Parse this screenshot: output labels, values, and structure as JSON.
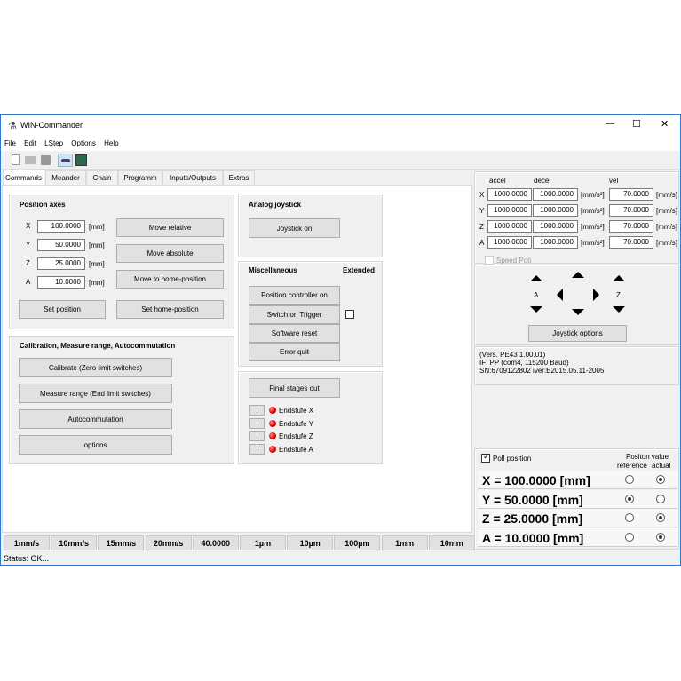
{
  "window": {
    "title": "WIN-Commander",
    "minimize": "—",
    "maximize": "☐",
    "close": "✕"
  },
  "menu": [
    "File",
    "Edit",
    "LStep",
    "Options",
    "Help"
  ],
  "toolbar": [
    "new-file-icon",
    "open-folder-icon",
    "save-icon",
    "connect-icon",
    "settings-tool-icon"
  ],
  "tabs": [
    "Commands",
    "Meander",
    "Chain",
    "Programm",
    "Inputs/Outputs",
    "Extras"
  ],
  "position_axes": {
    "title": "Position axes",
    "unit": "[mm]",
    "axes": [
      {
        "label": "X",
        "value": "100.0000"
      },
      {
        "label": "Y",
        "value": "50.0000"
      },
      {
        "label": "Z",
        "value": "25.0000"
      },
      {
        "label": "A",
        "value": "10.0000"
      }
    ],
    "buttons": {
      "move_relative": "Move relative",
      "move_absolute": "Move absolute",
      "move_home": "Move to home-position",
      "set_position": "Set position",
      "set_home": "Set home-position"
    }
  },
  "calibration": {
    "title": "Calibration, Measure range, Autocommutation",
    "buttons": [
      "Calibrate (Zero limit switches)",
      "Measure range (End limit switches)",
      "Autocommutation",
      "options"
    ]
  },
  "analog_joystick": {
    "title": "Analog joystick",
    "button": "Joystick on"
  },
  "misc": {
    "title": "Miscellaneous",
    "extended": "Extended",
    "buttons": [
      "Position controller on",
      "Switch on Trigger",
      "Software reset",
      "Error quit"
    ],
    "trigger_checked": false
  },
  "final": {
    "button": "Final stages out",
    "endstops": [
      {
        "btn": "I",
        "label": "Endstufe X"
      },
      {
        "btn": "I",
        "label": "Endstufe Y"
      },
      {
        "btn": "I",
        "label": "Endstufe Z"
      },
      {
        "btn": "I",
        "label": "Endstufe A"
      }
    ],
    "led_color": "#e00000"
  },
  "motion": {
    "headers": {
      "accel": "accel",
      "decel": "decel",
      "vel": "vel"
    },
    "accel_unit": "[mm/s²]",
    "vel_unit": "[mm/s]",
    "rows": [
      {
        "axis": "X",
        "accel": "1000.0000",
        "decel": "1000.0000",
        "vel": "70.0000"
      },
      {
        "axis": "Y",
        "accel": "1000.0000",
        "decel": "1000.0000",
        "vel": "70.0000"
      },
      {
        "axis": "Z",
        "accel": "1000.0000",
        "decel": "1000.0000",
        "vel": "70.0000"
      },
      {
        "axis": "A",
        "accel": "1000.0000",
        "decel": "1000.0000",
        "vel": "70.0000"
      }
    ],
    "speed_poti": "Speed Poti",
    "speed_poti_checked": false
  },
  "joystick": {
    "label_a": "A",
    "label_z": "Z",
    "options_button": "Joystick options"
  },
  "info": [
    "(Vers. PE43 1.00.01)",
    "IF: PP (com4, 115200 Baud)",
    "SN:6709122802 iver:E2015.05.11-2005"
  ],
  "poll": {
    "label": "Poll position",
    "checked": true,
    "header": "Positon value",
    "reference": "reference",
    "actual": "actual",
    "rows": [
      {
        "text": "X = 100.0000 [mm]",
        "selected": "actual"
      },
      {
        "text": "Y = 50.0000 [mm]",
        "selected": "reference"
      },
      {
        "text": "Z = 25.0000 [mm]",
        "selected": "actual"
      },
      {
        "text": "A = 10.0000 [mm]",
        "selected": "actual"
      }
    ]
  },
  "speed_buttons": [
    "1mm/s",
    "10mm/s",
    "15mm/s",
    "20mm/s",
    "40.0000",
    "1µm",
    "10µm",
    "100µm",
    "1mm",
    "10mm"
  ],
  "status": "Status: OK..."
}
